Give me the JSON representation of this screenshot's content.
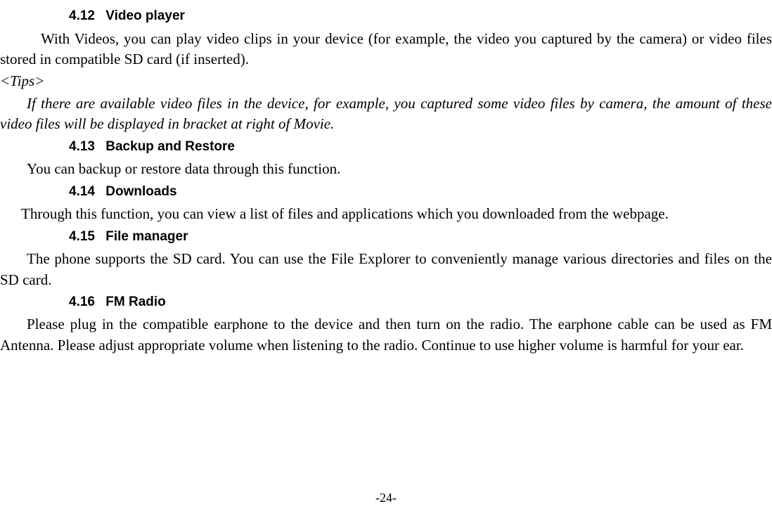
{
  "sections": {
    "s412": {
      "num": "4.12",
      "title": "Video player"
    },
    "s413": {
      "num": "4.13",
      "title": "Backup and Restore"
    },
    "s414": {
      "num": "4.14",
      "title": "Downloads"
    },
    "s415": {
      "num": "4.15",
      "title": "File manager"
    },
    "s416": {
      "num": "4.16",
      "title": "FM Radio"
    }
  },
  "body": {
    "p412": "With Videos, you can play video clips in your device (for example, the video you captured by the camera) or video files stored in compatible SD card (if inserted).",
    "tips_label": "<Tips>",
    "tips_body": "If there are available video files in the device, for example, you captured some video files by camera, the amount of these video files will be displayed in bracket at right of Movie.",
    "p413": "You can backup or restore data through this function.",
    "p414": "Through this function, you can view a list of files and applications which you downloaded from the webpage.",
    "p415": "The phone supports the SD card. You can use the File Explorer to conveniently manage various directories and files on the SD card.",
    "p416": "Please plug in the compatible earphone to the device and then turn on the radio. The earphone cable can be used as FM Antenna. Please adjust appropriate volume when listening to the radio. Continue to use higher volume is harmful for your ear."
  },
  "footer": {
    "page_number": "-24-"
  }
}
